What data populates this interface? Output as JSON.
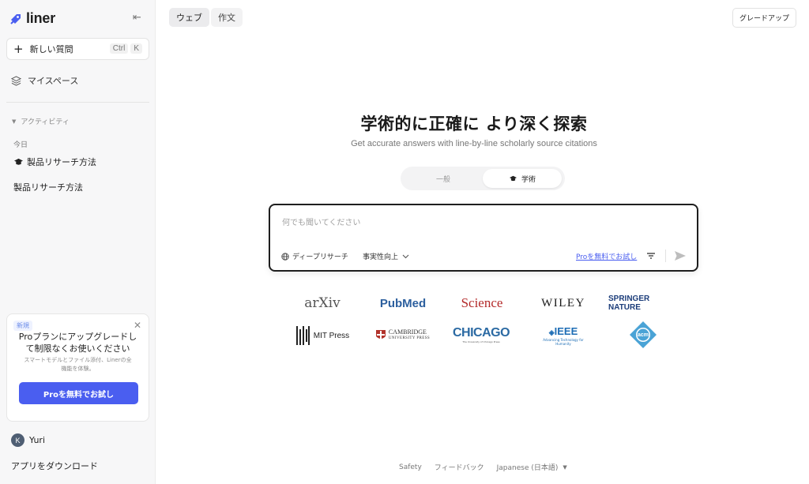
{
  "colors": {
    "accent": "#4a5ef0",
    "sidebar_bg": "#f7f7f8",
    "brand_icon": "#4a5ef0"
  },
  "sidebar": {
    "brand": "liner",
    "new_question": {
      "label": "新しい質問",
      "shortcut": [
        "Ctrl",
        "K"
      ]
    },
    "my_space": "マイスペース",
    "activity_label": "アクティビティ",
    "today_label": "今日",
    "history": [
      {
        "label": "製品リサーチ方法",
        "icon": "graduation-cap-icon"
      },
      {
        "label": "製品リサーチ方法"
      }
    ],
    "promo": {
      "badge": "新規",
      "title": "Proプランにアップグレードして制限なくお使いください",
      "description": "スマートモデルとファイル添付、Linerの全機能を体験。",
      "cta": "Proを無料でお試し"
    },
    "user": {
      "initial": "K",
      "name": "Yuri"
    },
    "download": "アプリをダウンロード"
  },
  "topbar": {
    "tabs": [
      {
        "label": "ウェブ"
      },
      {
        "label": "作文"
      }
    ],
    "upgrade": "グレードアップ"
  },
  "hero": {
    "title": "学術的に正確に より深く探索",
    "subtitle": "Get accurate answers with line-by-line scholarly source citations"
  },
  "mode": {
    "general": "一般",
    "academic": "学術",
    "selected": "academic"
  },
  "search": {
    "placeholder": "何でも聞いてください",
    "deep_research": "ディープリサーチ",
    "fact_mode": "事実性向上",
    "pro_link": "Proを無料でお試し"
  },
  "sources": [
    {
      "name": "arXiv"
    },
    {
      "name": "PubMed"
    },
    {
      "name": "Science"
    },
    {
      "name": "WILEY"
    },
    {
      "name": "SPRINGER NATURE"
    },
    {
      "name": "MIT Press"
    },
    {
      "name": "CAMBRIDGE",
      "sub": "UNIVERSITY PRESS"
    },
    {
      "name": "CHICAGO",
      "sub": "The University of Chicago Press"
    },
    {
      "name": "IEEE",
      "sub": "Advancing Technology for Humanity"
    },
    {
      "name": "acm"
    }
  ],
  "footer": {
    "safety": "Safety",
    "feedback": "フィードバック",
    "language": "Japanese (日本語)"
  }
}
